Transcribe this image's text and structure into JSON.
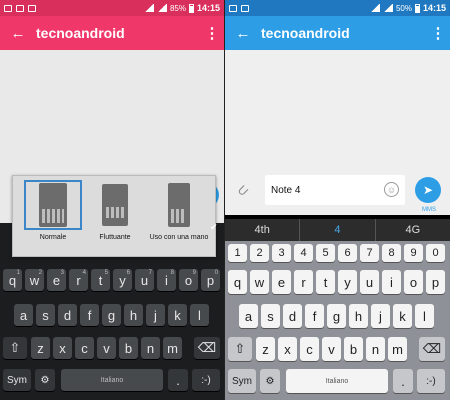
{
  "left": {
    "status": {
      "battery": "85%",
      "time": "14:15"
    },
    "appbar": {
      "title": "tecnoandroid",
      "back": "←",
      "more": "⋮"
    },
    "keyboard_popup": {
      "options": [
        "Normale",
        "Fluttuante",
        "Uso con una mano"
      ],
      "selected": "Normale"
    }
  },
  "right": {
    "status": {
      "battery": "50%",
      "time": "14:15"
    },
    "appbar": {
      "title": "tecnoandroid",
      "back": "←",
      "more": "⋮"
    },
    "compose": {
      "value": "Note 4",
      "mms_label": "MMS",
      "send_glyph": "➤",
      "smiley_glyph": "☺",
      "attach_glyph": "⊂"
    },
    "suggestions": [
      "4th",
      "4",
      "4G"
    ]
  },
  "keyboard": {
    "row_numbers": [
      "1",
      "2",
      "3",
      "4",
      "5",
      "6",
      "7",
      "8",
      "9",
      "0"
    ],
    "row1": [
      "q",
      "w",
      "e",
      "r",
      "t",
      "y",
      "u",
      "i",
      "o",
      "p"
    ],
    "row2": [
      "a",
      "s",
      "d",
      "f",
      "g",
      "h",
      "j",
      "k",
      "l"
    ],
    "row3": [
      "z",
      "x",
      "c",
      "v",
      "b",
      "n",
      "m"
    ],
    "shift": "⇧",
    "backspace": "⌫",
    "sym": "Sym",
    "settings": "⚙",
    "space": "Italiano",
    "period": ".",
    "smiley": ":-)",
    "caret": "✔"
  }
}
